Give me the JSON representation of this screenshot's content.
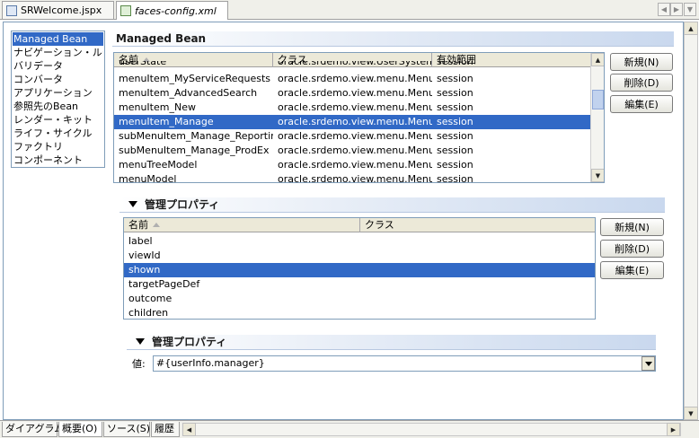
{
  "tabs": [
    {
      "label": "SRWelcome.jspx",
      "active": false,
      "icon": "jspx-file-icon"
    },
    {
      "label": "faces-config.xml",
      "active": true,
      "icon": "xml-file-icon"
    }
  ],
  "categories": [
    {
      "label": "Managed Bean",
      "selected": true
    },
    {
      "label": "ナビゲーション・ルール",
      "selected": false
    },
    {
      "label": "バリデータ",
      "selected": false
    },
    {
      "label": "コンバータ",
      "selected": false
    },
    {
      "label": "アプリケーション",
      "selected": false
    },
    {
      "label": "参照先のBean",
      "selected": false
    },
    {
      "label": "レンダー・キット",
      "selected": false
    },
    {
      "label": "ライフ・サイクル",
      "selected": false
    },
    {
      "label": "ファクトリ",
      "selected": false
    },
    {
      "label": "コンポーネント",
      "selected": false
    }
  ],
  "managed_bean": {
    "title": "Managed Bean",
    "columns": [
      "名前",
      "クラス",
      "有効範囲"
    ],
    "rows": [
      {
        "name": "userState",
        "class": "oracle.srdemo.view.UserSystemState",
        "scope": "session",
        "partial": true
      },
      {
        "name": "menuItem_MyServiceRequests",
        "class": "oracle.srdemo.view.menu.MenuIt…",
        "scope": "session"
      },
      {
        "name": "menuItem_AdvancedSearch",
        "class": "oracle.srdemo.view.menu.MenuIt…",
        "scope": "session"
      },
      {
        "name": "menuItem_New",
        "class": "oracle.srdemo.view.menu.MenuIt…",
        "scope": "session"
      },
      {
        "name": "menuItem_Manage",
        "class": "oracle.srdemo.view.menu.MenuIt…",
        "scope": "session",
        "selected": true
      },
      {
        "name": "subMenuItem_Manage_Reporting",
        "class": "oracle.srdemo.view.menu.MenuIt…",
        "scope": "session"
      },
      {
        "name": "subMenuItem_Manage_ProdEx",
        "class": "oracle.srdemo.view.menu.MenuIt…",
        "scope": "session"
      },
      {
        "name": "menuTreeModel",
        "class": "oracle.srdemo.view.menu.MenuT…",
        "scope": "session"
      },
      {
        "name": "menuModel",
        "class": "oracle.srdemo.view.menu.Menu…",
        "scope": "session",
        "partial": true
      }
    ],
    "buttons": {
      "new": "新規(N)",
      "delete": "削除(D)",
      "edit": "編集(E)"
    }
  },
  "managed_properties": {
    "title": "管理プロパティ",
    "columns": [
      "名前",
      "クラス"
    ],
    "rows": [
      {
        "name": "label",
        "class": ""
      },
      {
        "name": "viewId",
        "class": ""
      },
      {
        "name": "shown",
        "class": "",
        "selected": true
      },
      {
        "name": "targetPageDef",
        "class": ""
      },
      {
        "name": "outcome",
        "class": ""
      },
      {
        "name": "children",
        "class": ""
      }
    ],
    "buttons": {
      "new": "新規(N)",
      "delete": "削除(D)",
      "edit": "編集(E)"
    }
  },
  "property_value": {
    "title": "管理プロパティ",
    "label": "値:",
    "value": "#{userInfo.manager}"
  },
  "bottom_tabs": [
    {
      "label": "ダイアグラム",
      "active": false
    },
    {
      "label": "概要(O)",
      "active": true
    },
    {
      "label": "ソース(S)",
      "active": false
    },
    {
      "label": "履歴",
      "active": false
    }
  ],
  "colors": {
    "selection": "#3169c6",
    "border": "#7f9db9"
  }
}
